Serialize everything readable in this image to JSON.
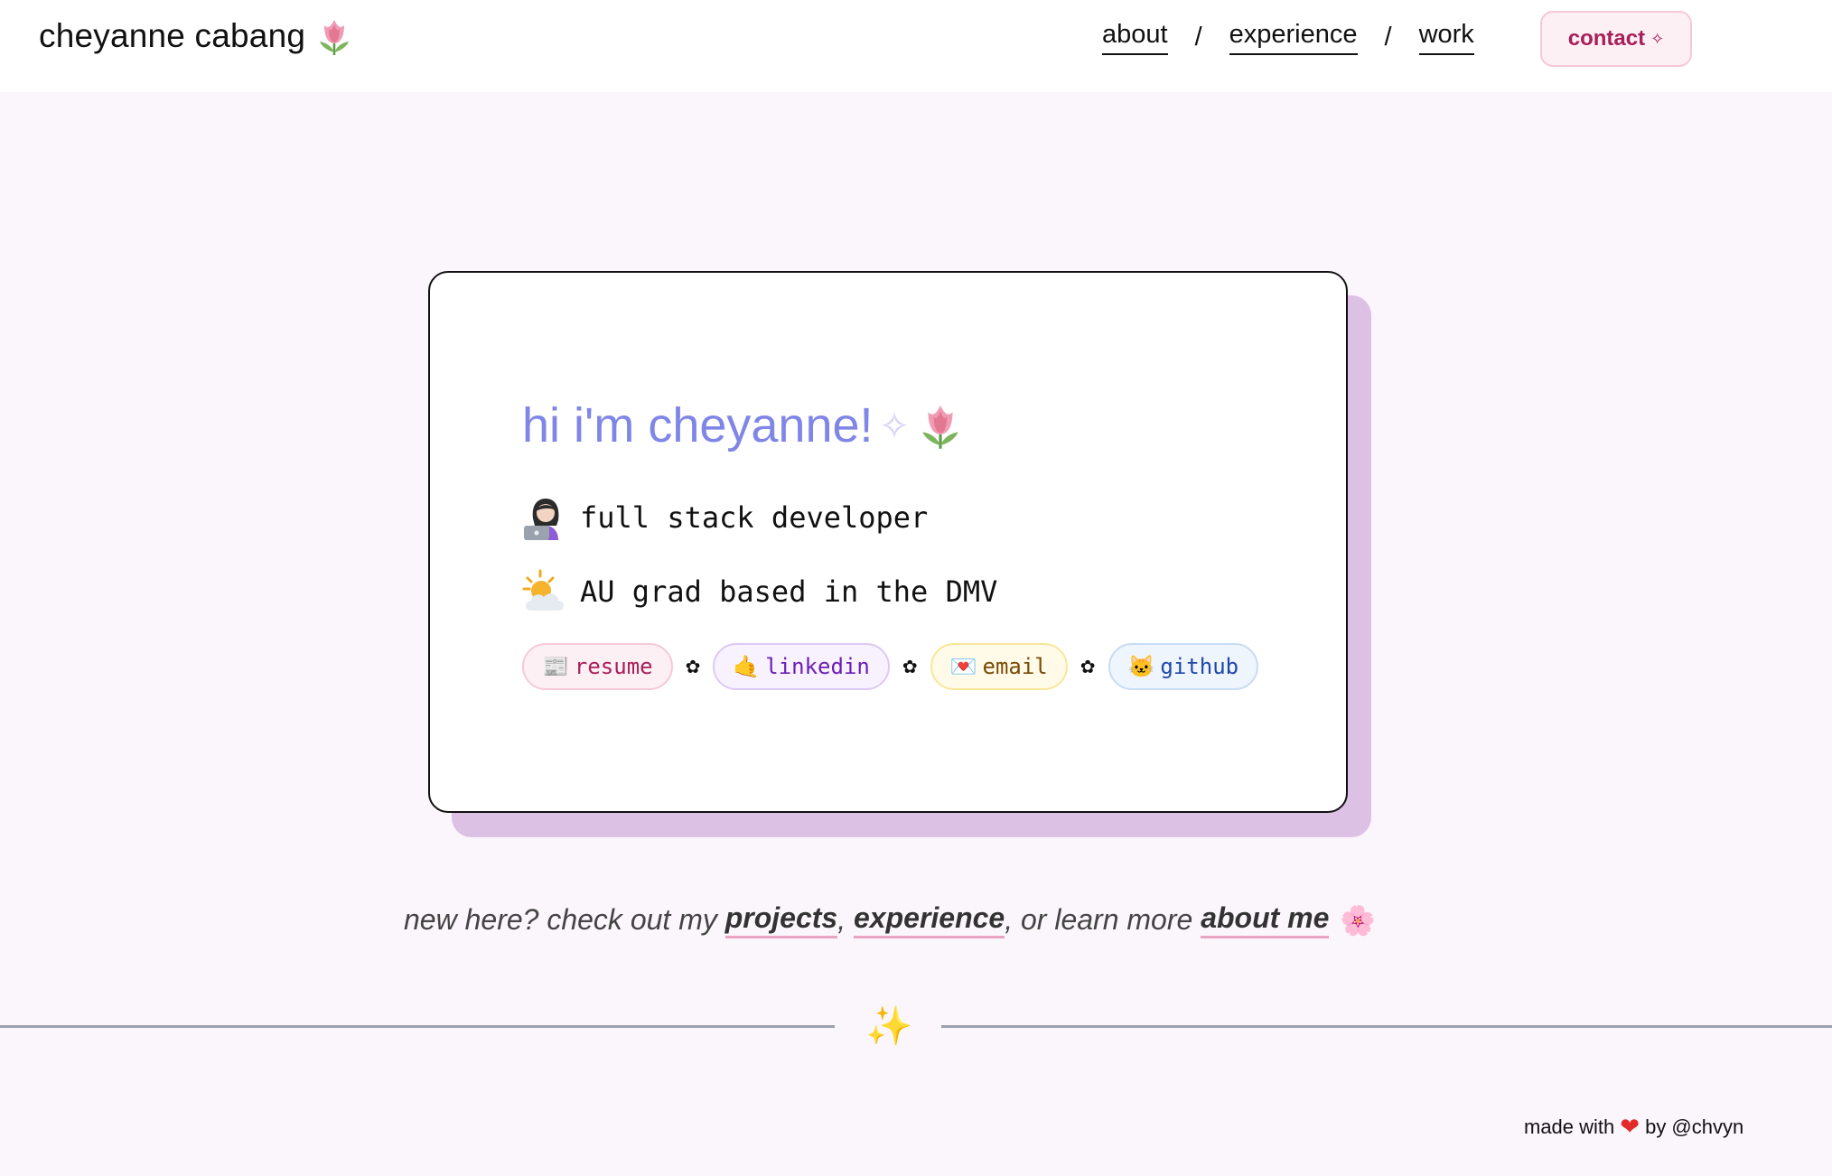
{
  "header": {
    "logo_text": "cheyanne cabang",
    "logo_icon": "tulip-icon",
    "nav": [
      {
        "label": "about"
      },
      {
        "label": "experience"
      },
      {
        "label": "work"
      }
    ],
    "nav_separator": "/",
    "contact_label": "contact",
    "contact_icon": "✧"
  },
  "hero": {
    "greeting": "hi i'm cheyanne!",
    "greeting_sparkle": "✧",
    "role": "full stack developer",
    "role_icon": "woman-technologist-icon",
    "location": "AU grad based in the DMV",
    "location_icon": "sun-behind-cloud-icon",
    "links": [
      {
        "label": "resume",
        "icon": "📰"
      },
      {
        "label": "linkedin",
        "icon": "🤙"
      },
      {
        "label": "email",
        "icon": "💌"
      },
      {
        "label": "github",
        "icon": "🐱"
      }
    ],
    "link_separator": "✿",
    "colors": {
      "greeting": "#7f86e6",
      "card_shadow": "#dcc1e4"
    }
  },
  "cta": {
    "prefix": "new here? check out my ",
    "projects": "projects",
    "comma1": ", ",
    "experience": "experience",
    "middle": ", or learn more ",
    "about": "about me",
    "blossom": "🌸"
  },
  "divider": {
    "sparkle": "✨"
  },
  "footer": {
    "prefix": "made with",
    "heart": "❤",
    "suffix": "by @chvyn"
  }
}
